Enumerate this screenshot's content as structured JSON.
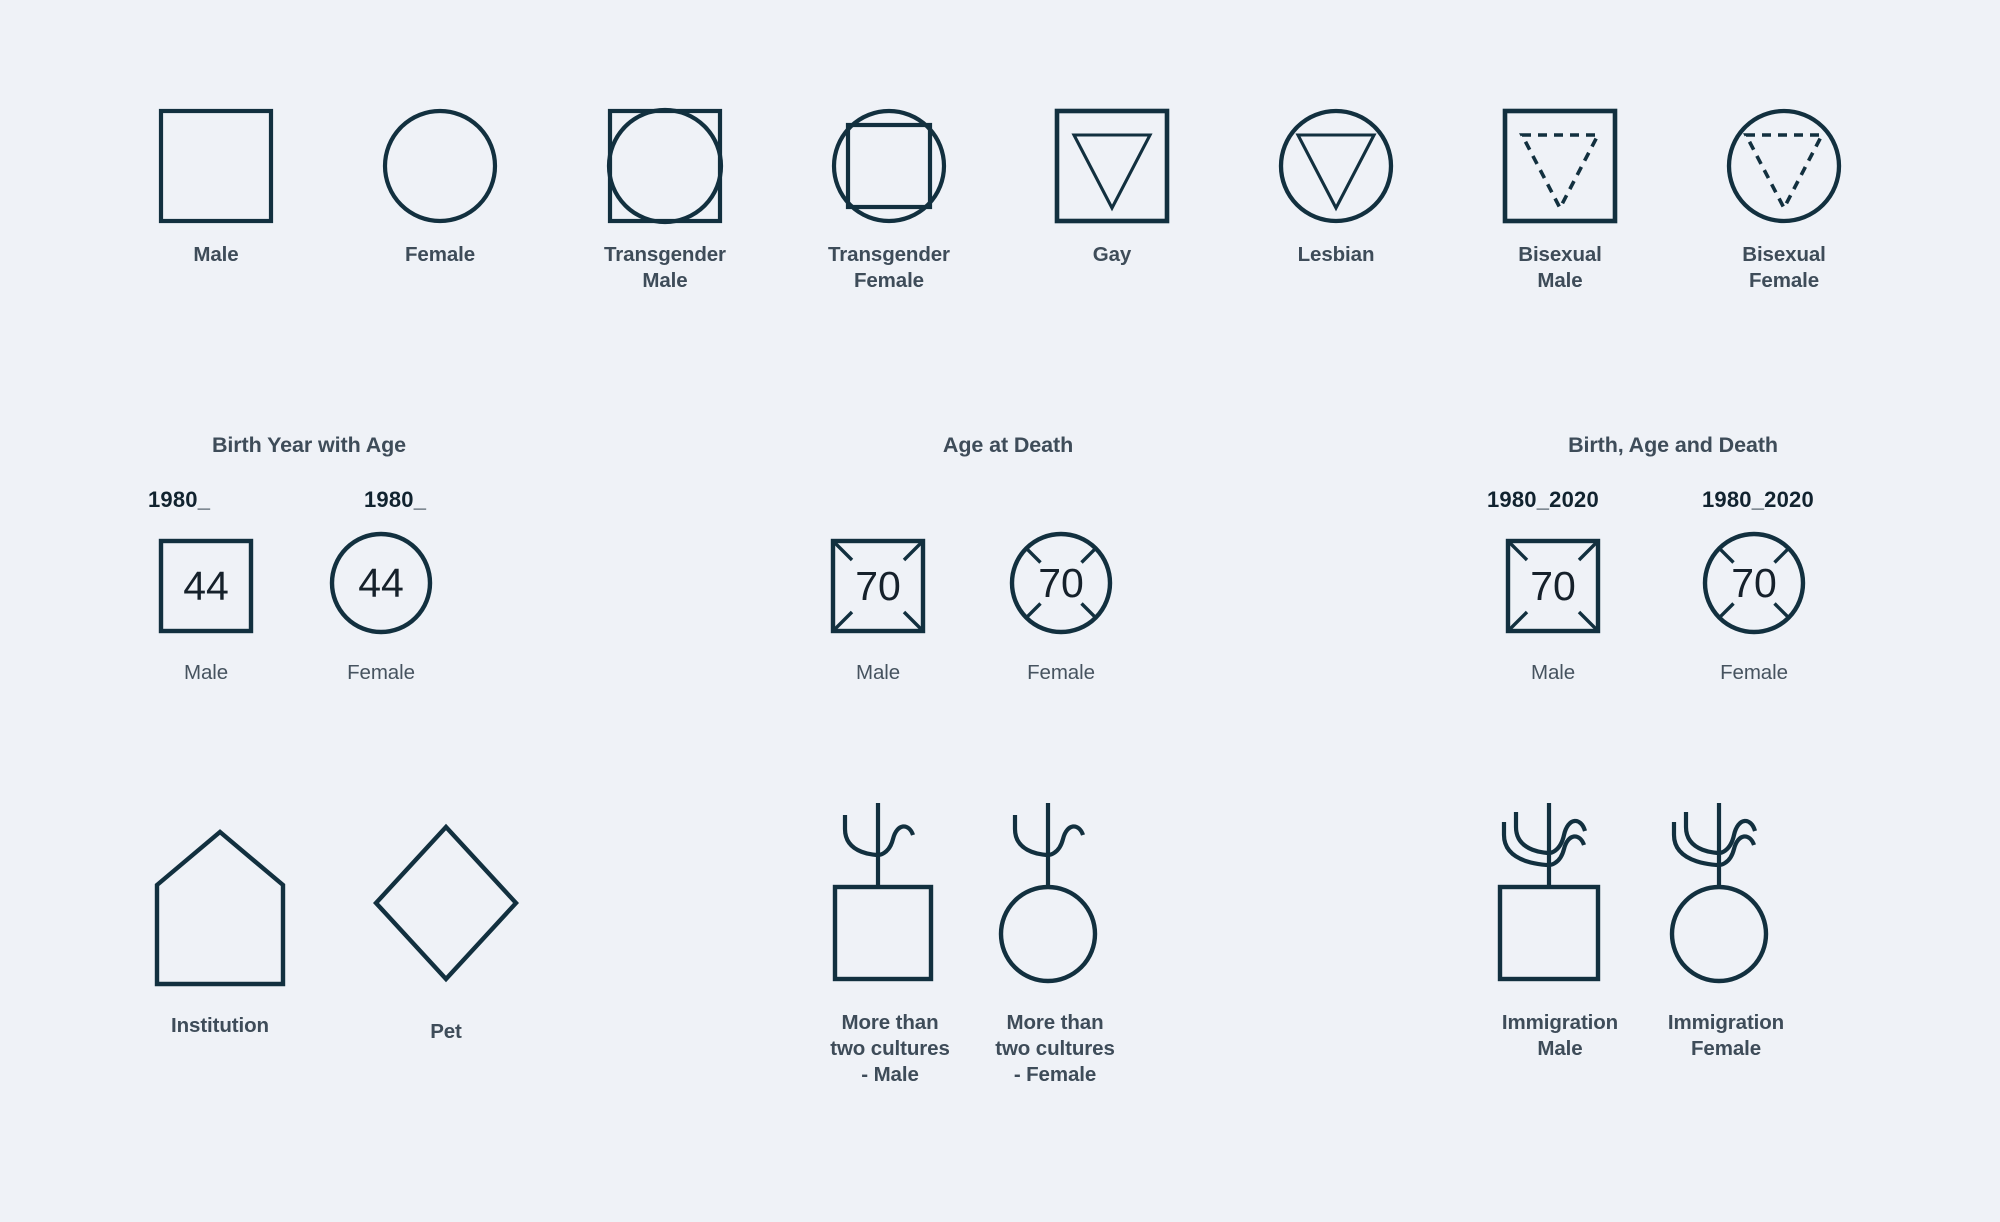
{
  "theme": {
    "background": "#eff2f7",
    "stroke": "#12303f",
    "text": "#3e4c59",
    "text_dark": "#11232f"
  },
  "row1": {
    "items": [
      {
        "id": "male",
        "label": "Male",
        "icon": "square-icon"
      },
      {
        "id": "female",
        "label": "Female",
        "icon": "circle-icon"
      },
      {
        "id": "transgender-male",
        "label": "Transgender\nMale",
        "label_line1": "Transgender",
        "label_line2": "Male",
        "icon": "square-with-circle-icon"
      },
      {
        "id": "transgender-female",
        "label": "Transgender\nFemale",
        "label_line1": "Transgender",
        "label_line2": "Female",
        "icon": "circle-with-square-icon"
      },
      {
        "id": "gay",
        "label": "Gay",
        "icon": "square-with-triangle-icon"
      },
      {
        "id": "lesbian",
        "label": "Lesbian",
        "icon": "circle-with-triangle-icon"
      },
      {
        "id": "bisexual-male",
        "label": "Bisexual\nMale",
        "label_line1": "Bisexual",
        "label_line2": "Male",
        "icon": "square-with-dashed-triangle-icon"
      },
      {
        "id": "bisexual-female",
        "label": "Bisexual\nFemale",
        "label_line1": "Bisexual",
        "label_line2": "Female",
        "icon": "circle-with-dashed-triangle-icon"
      }
    ]
  },
  "sections": {
    "birth_year_with_age": {
      "title": "Birth Year with Age",
      "items": [
        {
          "id": "birth-male",
          "year": "1980_",
          "age": "44",
          "label": "Male",
          "icon": "square-icon"
        },
        {
          "id": "birth-female",
          "year": "1980_",
          "age": "44",
          "label": "Female",
          "icon": "circle-icon"
        }
      ]
    },
    "age_at_death": {
      "title": "Age at Death",
      "items": [
        {
          "id": "death-male",
          "age": "70",
          "label": "Male",
          "icon": "square-death-icon"
        },
        {
          "id": "death-female",
          "age": "70",
          "label": "Female",
          "icon": "circle-death-icon"
        }
      ]
    },
    "birth_age_and_death": {
      "title": "Birth, Age and Death",
      "items": [
        {
          "id": "bad-male",
          "year": "1980_2020",
          "age": "70",
          "label": "Male",
          "icon": "square-death-icon"
        },
        {
          "id": "bad-female",
          "year": "1980_2020",
          "age": "70",
          "label": "Female",
          "icon": "circle-death-icon"
        }
      ]
    }
  },
  "row3": {
    "items": [
      {
        "id": "institution",
        "label": "Institution",
        "icon": "house-pentagon-icon"
      },
      {
        "id": "pet",
        "label": "Pet",
        "icon": "diamond-icon"
      },
      {
        "id": "cultures-male",
        "label": "More than two cultures - Male",
        "label_line1": "More than",
        "label_line2": "two cultures",
        "label_line3": "- Male",
        "icon": "square-with-sprout-icon"
      },
      {
        "id": "cultures-female",
        "label": "More than two cultures - Female",
        "label_line1": "More than",
        "label_line2": "two cultures",
        "label_line3": "- Female",
        "icon": "circle-with-sprout-icon"
      },
      {
        "id": "immigration-male",
        "label": "Immigration Male",
        "label_line1": "Immigration",
        "label_line2": "Male",
        "icon": "square-with-double-sprout-icon"
      },
      {
        "id": "immigration-female",
        "label": "Immigration Female",
        "label_line1": "Immigration",
        "label_line2": "Female",
        "icon": "circle-with-double-sprout-icon"
      }
    ]
  }
}
